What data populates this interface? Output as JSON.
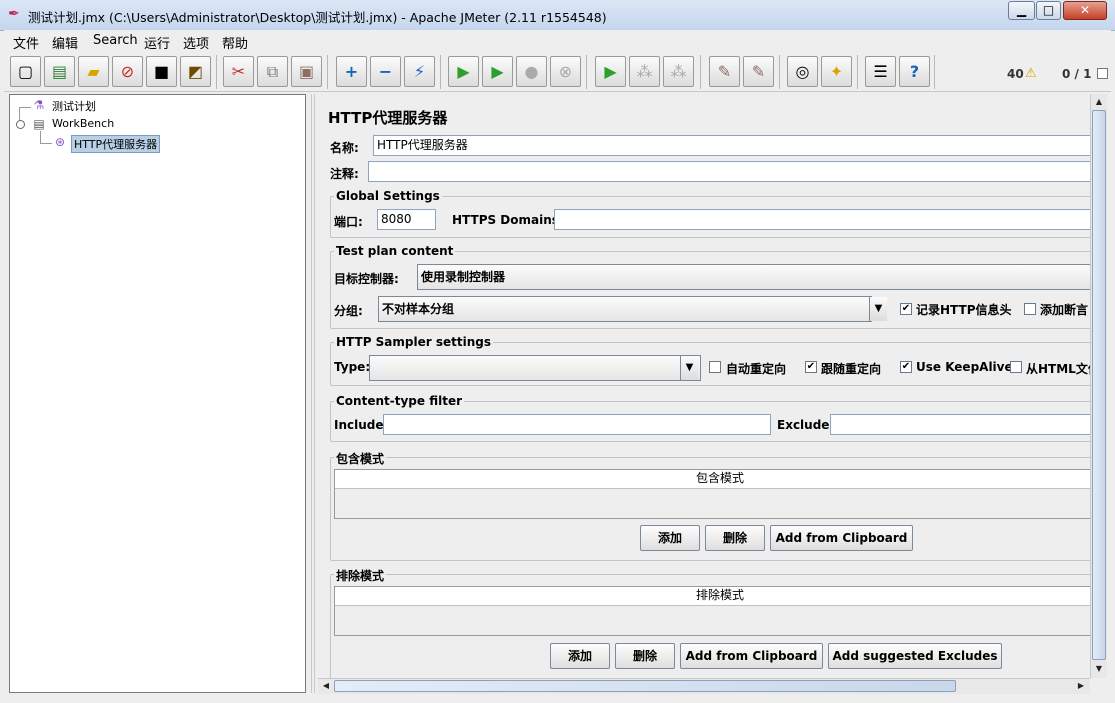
{
  "window": {
    "title": "测试计划.jmx (C:\\Users\\Administrator\\Desktop\\测试计划.jmx) - Apache JMeter (2.11 r1554548)",
    "logo_icon": "jmeter-feather-icon",
    "minimize": "▁",
    "maximize": "□",
    "close": "✕"
  },
  "menu": [
    "文件",
    "编辑",
    "Search",
    "运行",
    "选项",
    "帮助"
  ],
  "toolbar": {
    "buttons": [
      "new-icon",
      "templates-icon",
      "open-icon",
      "close-file-icon",
      "save-icon",
      "save-as-image-icon",
      "cut-icon",
      "copy-icon",
      "paste-icon",
      "expand-icon",
      "collapse-icon",
      "toggle-icon",
      "start-icon",
      "start-no-pause-icon",
      "stop-icon",
      "shutdown-icon",
      "remote-start-icon",
      "remote-stop-icon",
      "remote-shutdown-icon",
      "clear-icon",
      "clear-all-icon",
      "search-icon",
      "reset-search-icon",
      "function-helper-icon",
      "help-icon"
    ],
    "warning_count": "40",
    "threads": "0 / 1"
  },
  "tree": {
    "items": [
      {
        "label": "测试计划",
        "icon": "test-plan-icon"
      },
      {
        "label": "WorkBench",
        "icon": "workbench-icon"
      },
      {
        "label": "HTTP代理服务器",
        "icon": "proxy-server-icon"
      }
    ]
  },
  "panel": {
    "heading": "HTTP代理服务器",
    "name_label": "名称:",
    "name_value": "HTTP代理服务器",
    "comment_label": "注释:",
    "comment_value": "",
    "global": {
      "title": "Global Settings",
      "port_label": "端口:",
      "port_value": "8080",
      "https_label": "HTTPS Domains :",
      "https_value": ""
    },
    "testplan": {
      "title": "Test plan content",
      "target_label": "目标控制器:",
      "target_value": "使用录制控制器",
      "group_label": "分组:",
      "group_value": "不对样本分组",
      "record_headers": "记录HTTP信息头",
      "add_assertions": "添加断言"
    },
    "sampler": {
      "title": "HTTP Sampler settings",
      "type_label": "Type:",
      "type_value": "",
      "redirect_auto": "自动重定向",
      "follow_redirects": "跟随重定向",
      "keepalive": "Use KeepAlive",
      "from_html": "从HTML文件"
    },
    "content_filter": {
      "title": "Content-type filter",
      "include_label": "Include:",
      "exclude_label": "Exclude:"
    },
    "include_patterns": {
      "title": "包含模式",
      "column": "包含模式",
      "add": "添加",
      "delete": "删除",
      "clipboard": "Add from Clipboard"
    },
    "exclude_patterns": {
      "title": "排除模式",
      "column": "排除模式",
      "add": "添加",
      "delete": "删除",
      "clipboard": "Add from Clipboard",
      "suggested": "Add suggested Excludes"
    }
  }
}
